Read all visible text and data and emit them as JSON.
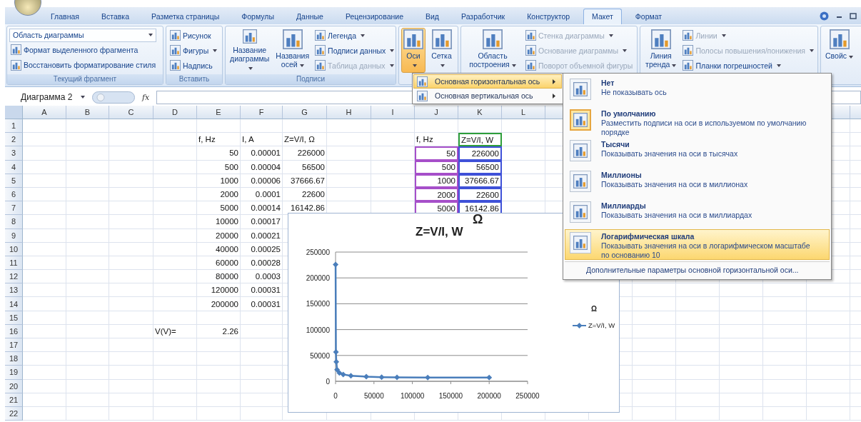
{
  "ribbon_tabs": [
    {
      "label": "Главная",
      "selected": false
    },
    {
      "label": "Вставка",
      "selected": false
    },
    {
      "label": "Разметка страницы",
      "selected": false
    },
    {
      "label": "Формулы",
      "selected": false
    },
    {
      "label": "Данные",
      "selected": false
    },
    {
      "label": "Рецензирование",
      "selected": false
    },
    {
      "label": "Вид",
      "selected": false
    },
    {
      "label": "Разработчик",
      "selected": false
    },
    {
      "label": "Конструктор",
      "selected": false
    },
    {
      "label": "Макет",
      "selected": true
    },
    {
      "label": "Формат",
      "selected": false
    }
  ],
  "ribbon": {
    "groups": [
      {
        "label": "Текущий фрагмент",
        "dropdown": {
          "value": "Область диаграммы"
        },
        "buttons": [
          {
            "label": "Формат выделенного фрагмента",
            "kind": "small",
            "dropdown": false,
            "disabled": false,
            "pressed": false
          },
          {
            "label": "Восстановить форматирование стиля",
            "kind": "small",
            "dropdown": false,
            "disabled": false,
            "pressed": false
          }
        ]
      },
      {
        "label": "Вставить",
        "buttons": [
          {
            "label": "Рисунок",
            "kind": "small",
            "dropdown": false,
            "disabled": false,
            "pressed": false
          },
          {
            "label": "Фигуры",
            "kind": "small",
            "dropdown": true,
            "disabled": false,
            "pressed": false
          },
          {
            "label": "Надпись",
            "kind": "small",
            "dropdown": false,
            "disabled": false,
            "pressed": false
          }
        ]
      },
      {
        "label": "Подписи",
        "buttons": [
          {
            "label": "Название диаграммы",
            "kind": "large",
            "dropdown": true,
            "disabled": false,
            "pressed": false
          },
          {
            "label": "Названия осей",
            "kind": "large",
            "dropdown": true,
            "disabled": false,
            "pressed": false
          },
          {
            "label": "Легенда",
            "kind": "small",
            "dropdown": true,
            "disabled": false,
            "pressed": false
          },
          {
            "label": "Подписи данных",
            "kind": "small",
            "dropdown": true,
            "disabled": false,
            "pressed": false
          },
          {
            "label": "Таблица данных",
            "kind": "small",
            "dropdown": true,
            "disabled": true,
            "pressed": false
          }
        ]
      },
      {
        "buttons": [
          {
            "label": "Оси",
            "kind": "large",
            "dropdown": true,
            "disabled": false,
            "pressed": true
          },
          {
            "label": "Сетка",
            "kind": "large",
            "dropdown": true,
            "disabled": false,
            "pressed": false
          }
        ]
      },
      {
        "buttons": [
          {
            "label": "Область построения",
            "kind": "large",
            "dropdown": true,
            "disabled": false,
            "pressed": false
          },
          {
            "label": "Стенка диаграммы",
            "kind": "small",
            "dropdown": true,
            "disabled": true,
            "pressed": false
          },
          {
            "label": "Основание диаграммы",
            "kind": "small",
            "dropdown": true,
            "disabled": true,
            "pressed": false
          },
          {
            "label": "Поворот объемной фигуры",
            "kind": "small",
            "dropdown": false,
            "disabled": true,
            "pressed": false
          }
        ]
      },
      {
        "buttons": [
          {
            "label": "Линия тренда",
            "kind": "large",
            "dropdown": true,
            "disabled": false,
            "pressed": false
          },
          {
            "label": "Линии",
            "kind": "small",
            "dropdown": true,
            "disabled": true,
            "pressed": false
          },
          {
            "label": "Полосы повышения/понижения",
            "kind": "small",
            "dropdown": true,
            "disabled": true,
            "pressed": false
          },
          {
            "label": "Планки погрешностей",
            "kind": "small",
            "dropdown": true,
            "disabled": false,
            "pressed": false
          }
        ]
      },
      {
        "buttons": [
          {
            "label": "Свойс",
            "kind": "large",
            "dropdown": true,
            "disabled": false,
            "pressed": false
          }
        ]
      }
    ]
  },
  "formula_bar": {
    "name_box": "Диаграмма 2",
    "function_button": "fx"
  },
  "sheet": {
    "columns": [
      "A",
      "B",
      "C",
      "D",
      "E",
      "F",
      "G",
      "H",
      "I",
      "J",
      "K",
      "L"
    ],
    "rows": [
      {
        "number": "1"
      },
      {
        "number": "2",
        "cells": {
          "E": {
            "text": "f, Hz",
            "kind": "text"
          },
          "F": {
            "text": "I, A",
            "kind": "text"
          },
          "G": {
            "text": "Z=V/I, Ω",
            "kind": "text"
          },
          "J": {
            "text": "f, Hz",
            "kind": "text"
          },
          "K": {
            "text": "Z=V/I, W",
            "kind": "text",
            "color": "#2e9e3a"
          }
        }
      },
      {
        "number": "3",
        "cells": {
          "E": {
            "text": "50",
            "kind": "number"
          },
          "F": {
            "text": "0.00001",
            "kind": "number"
          },
          "G": {
            "text": "226000",
            "kind": "number"
          },
          "J": {
            "text": "50",
            "kind": "number",
            "color": "#a64fc9"
          },
          "K": {
            "text": "226000",
            "kind": "number",
            "color": "#3f51d8"
          }
        }
      },
      {
        "number": "4",
        "cells": {
          "E": {
            "text": "500",
            "kind": "number"
          },
          "F": {
            "text": "0.00004",
            "kind": "number"
          },
          "G": {
            "text": "56500",
            "kind": "number"
          },
          "J": {
            "text": "500",
            "kind": "number",
            "color": "#a64fc9"
          },
          "K": {
            "text": "56500",
            "kind": "number",
            "color": "#3f51d8"
          }
        }
      },
      {
        "number": "5",
        "cells": {
          "E": {
            "text": "1000",
            "kind": "number"
          },
          "F": {
            "text": "0.00006",
            "kind": "number"
          },
          "G": {
            "text": "37666.67",
            "kind": "number"
          },
          "J": {
            "text": "1000",
            "kind": "number",
            "color": "#a64fc9"
          },
          "K": {
            "text": "37666.67",
            "kind": "number",
            "color": "#3f51d8"
          }
        }
      },
      {
        "number": "6",
        "cells": {
          "E": {
            "text": "2000",
            "kind": "number"
          },
          "F": {
            "text": "0.0001",
            "kind": "number"
          },
          "G": {
            "text": "22600",
            "kind": "number"
          },
          "J": {
            "text": "2000",
            "kind": "number",
            "color": "#a64fc9"
          },
          "K": {
            "text": "22600",
            "kind": "number",
            "color": "#3f51d8"
          }
        }
      },
      {
        "number": "7",
        "cells": {
          "E": {
            "text": "5000",
            "kind": "number"
          },
          "F": {
            "text": "0.00014",
            "kind": "number"
          },
          "G": {
            "text": "16142.86",
            "kind": "number"
          },
          "J": {
            "text": "5000",
            "kind": "number",
            "color": "#a64fc9"
          },
          "K": {
            "text": "16142.86",
            "kind": "number",
            "color": "#3f51d8"
          }
        }
      },
      {
        "number": "8",
        "cells": {
          "E": {
            "text": "10000",
            "kind": "number"
          },
          "F": {
            "text": "0.00017",
            "kind": "number"
          }
        }
      },
      {
        "number": "9",
        "cells": {
          "E": {
            "text": "20000",
            "kind": "number"
          },
          "F": {
            "text": "0.00021",
            "kind": "number"
          }
        }
      },
      {
        "number": "10",
        "cells": {
          "E": {
            "text": "40000",
            "kind": "number"
          },
          "F": {
            "text": "0.00025",
            "kind": "number"
          }
        }
      },
      {
        "number": "11",
        "cells": {
          "E": {
            "text": "60000",
            "kind": "number"
          },
          "F": {
            "text": "0.00028",
            "kind": "number"
          }
        }
      },
      {
        "number": "12",
        "cells": {
          "E": {
            "text": "80000",
            "kind": "number"
          },
          "F": {
            "text": "0.0003",
            "kind": "number"
          }
        }
      },
      {
        "number": "13",
        "cells": {
          "E": {
            "text": "120000",
            "kind": "number"
          },
          "F": {
            "text": "0.00031",
            "kind": "number"
          }
        }
      },
      {
        "number": "14",
        "cells": {
          "E": {
            "text": "200000",
            "kind": "number"
          },
          "F": {
            "text": "0.00031",
            "kind": "number"
          }
        }
      },
      {
        "number": "15"
      },
      {
        "number": "16",
        "cells": {
          "D": {
            "text": "V(V)=",
            "kind": "text"
          },
          "E": {
            "text": "2.26",
            "kind": "number"
          }
        }
      },
      {
        "number": "17"
      },
      {
        "number": "18"
      },
      {
        "number": "19"
      },
      {
        "number": "20"
      },
      {
        "number": "21"
      },
      {
        "number": "22"
      }
    ]
  },
  "chart": {
    "title_mark": "Ω",
    "legend_mark": "Ω",
    "chart_data": {
      "type": "line",
      "title": "Z=V/I, W",
      "grid": true,
      "x": [
        50,
        500,
        1000,
        2000,
        5000,
        10000,
        20000,
        40000,
        60000,
        80000,
        120000,
        200000
      ],
      "series": [
        {
          "name": "Z=V/I, W",
          "color": "#4a7ebb",
          "marker": "diamond",
          "values": [
            226000,
            56500,
            37666.67,
            22600,
            16142.86,
            13294.12,
            10761.9,
            9040,
            8071.43,
            7533.33,
            7290.32,
            7290.32
          ]
        }
      ],
      "xlim": [
        0,
        250000
      ],
      "ylim": [
        0,
        250000
      ],
      "xticks": [
        0,
        50000,
        100000,
        150000,
        200000,
        250000
      ],
      "yticks": [
        0,
        50000,
        100000,
        150000,
        200000,
        250000
      ]
    }
  },
  "axes_menu": {
    "items": [
      {
        "label": "Основная горизонтальная ось",
        "selected": true
      },
      {
        "label": "Основная вертикальная ось",
        "selected": false
      }
    ]
  },
  "axis_submenu": {
    "items": [
      {
        "title": "Нет",
        "description": "Не показывать ось",
        "selected": false,
        "hovered": false
      },
      {
        "title": "По умолчанию",
        "description": "Разместить подписи на оси в используемом по умолчанию порядке",
        "selected": true,
        "hovered": false
      },
      {
        "title": "Тысячи",
        "description": "Показывать значения на оси в тысячах",
        "selected": false,
        "hovered": false
      },
      {
        "title": "Миллионы",
        "description": "Показывать значения на оси в миллионах",
        "selected": false,
        "hovered": false
      },
      {
        "title": "Миллиарды",
        "description": "Показывать значения на оси в миллиардах",
        "selected": false,
        "hovered": false
      },
      {
        "title": "Логарифмическая шкала",
        "description": "Показывать значения на оси в логарифмическом масштабе по основанию 10",
        "selected": false,
        "hovered": true
      }
    ],
    "footer": "Дополнительные параметры основной горизонтальной оси..."
  }
}
